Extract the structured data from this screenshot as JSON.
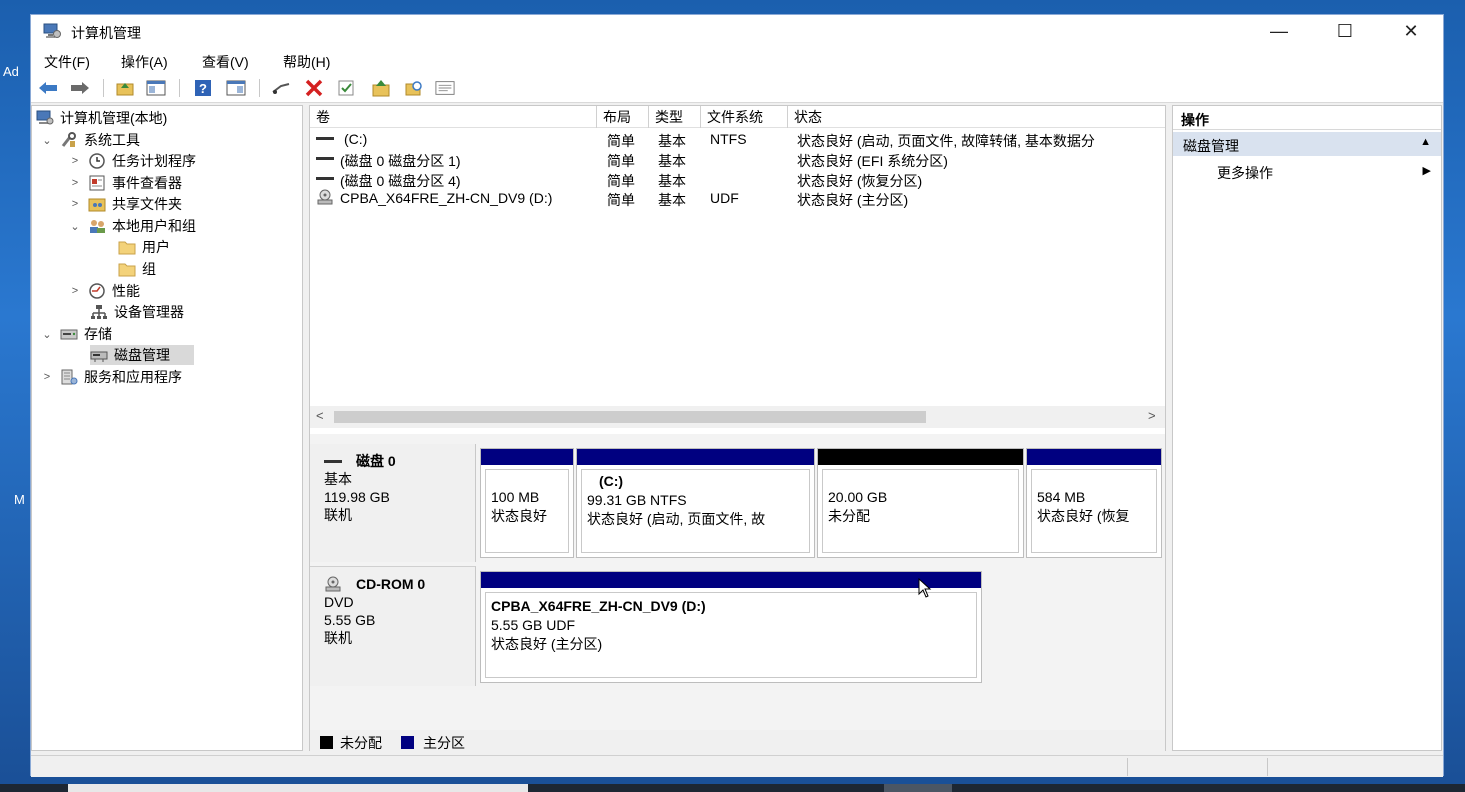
{
  "window": {
    "title": "计算机管理"
  },
  "window_controls": {
    "minimize": "—",
    "maximize": "☐",
    "close": "✕"
  },
  "menu": [
    "文件(F)",
    "操作(A)",
    "查看(V)",
    "帮助(H)"
  ],
  "tree": [
    {
      "label": "计算机管理(本地)",
      "icon": "computer-mgmt-icon",
      "toggle": ""
    },
    {
      "label": "系统工具",
      "icon": "system-tools-icon",
      "toggle": "⌄"
    },
    {
      "label": "任务计划程序",
      "icon": "clock-icon",
      "toggle": ">"
    },
    {
      "label": "事件查看器",
      "icon": "event-viewer-icon",
      "toggle": ">"
    },
    {
      "label": "共享文件夹",
      "icon": "shared-folder-icon",
      "toggle": ">"
    },
    {
      "label": "本地用户和组",
      "icon": "users-icon",
      "toggle": "⌄"
    },
    {
      "label": "用户",
      "icon": "folder-icon",
      "toggle": ""
    },
    {
      "label": "组",
      "icon": "folder-icon",
      "toggle": ""
    },
    {
      "label": "性能",
      "icon": "performance-icon",
      "toggle": ">"
    },
    {
      "label": "设备管理器",
      "icon": "device-manager-icon",
      "toggle": ""
    },
    {
      "label": "存储",
      "icon": "storage-icon",
      "toggle": "⌄"
    },
    {
      "label": "磁盘管理",
      "icon": "disk-management-icon",
      "toggle": ""
    },
    {
      "label": "服务和应用程序",
      "icon": "services-icon",
      "toggle": ">"
    }
  ],
  "volume_list": {
    "columns": [
      "卷",
      "布局",
      "类型",
      "文件系统",
      "状态"
    ],
    "rows": [
      {
        "volume": "(C:)",
        "layout": "简单",
        "type": "基本",
        "fs": "NTFS",
        "status": "状态良好 (启动, 页面文件, 故障转储, 基本数据分"
      },
      {
        "volume": "(磁盘 0 磁盘分区 1)",
        "layout": "简单",
        "type": "基本",
        "fs": "",
        "status": "状态良好 (EFI 系统分区)"
      },
      {
        "volume": "(磁盘 0 磁盘分区 4)",
        "layout": "简单",
        "type": "基本",
        "fs": "",
        "status": "状态良好 (恢复分区)"
      },
      {
        "volume": "CPBA_X64FRE_ZH-CN_DV9 (D:)",
        "layout": "简单",
        "type": "基本",
        "fs": "UDF",
        "status": "状态良好 (主分区)"
      }
    ]
  },
  "scroll": {
    "left": "<",
    "right": ">"
  },
  "disks": [
    {
      "name": "磁盘 0",
      "type": "基本",
      "size": "119.98 GB",
      "state": "联机",
      "partitions": [
        {
          "title": "",
          "line1": "100 MB",
          "line2": "状态良好",
          "kind": "primary"
        },
        {
          "title": "(C:)",
          "line1": "99.31 GB NTFS",
          "line2": "状态良好 (启动, 页面文件, 故",
          "kind": "primary"
        },
        {
          "title": "",
          "line1": "20.00 GB",
          "line2": "未分配",
          "kind": "unallocated"
        },
        {
          "title": "",
          "line1": "584 MB",
          "line2": "状态良好 (恢复",
          "kind": "primary"
        }
      ]
    },
    {
      "name": "CD-ROM 0",
      "type": "DVD",
      "size": "5.55 GB",
      "state": "联机",
      "partitions": [
        {
          "title": "CPBA_X64FRE_ZH-CN_DV9  (D:)",
          "line1": "5.55 GB UDF",
          "line2": "状态良好 (主分区)",
          "kind": "primary"
        }
      ]
    }
  ],
  "legend": [
    {
      "label": "未分配",
      "color": "#000000"
    },
    {
      "label": "主分区",
      "color": "#000080"
    }
  ],
  "actions": {
    "header": "操作",
    "section": "磁盘管理",
    "more": "更多操作",
    "section_arrow": "▲",
    "more_arrow": "▶"
  },
  "desktop": {
    "frag1": "Ad",
    "frag2": "M"
  },
  "colors": {
    "primary": "#000080",
    "unallocated": "#000000",
    "selection": "#d9e2ef"
  }
}
